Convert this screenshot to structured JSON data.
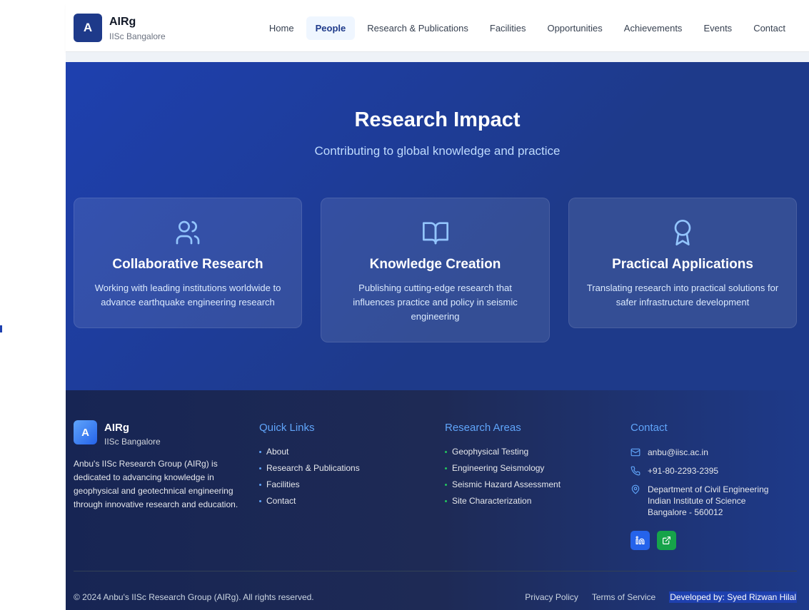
{
  "header": {
    "logo_letter": "A",
    "brand_name": "AIRg",
    "brand_sub": "IISc Bangalore",
    "nav": [
      {
        "label": "Home",
        "active": false
      },
      {
        "label": "People",
        "active": true
      },
      {
        "label": "Research & Publications",
        "active": false
      },
      {
        "label": "Facilities",
        "active": false
      },
      {
        "label": "Opportunities",
        "active": false
      },
      {
        "label": "Achievements",
        "active": false
      },
      {
        "label": "Events",
        "active": false
      },
      {
        "label": "Contact",
        "active": false
      }
    ]
  },
  "hero": {
    "title": "Research Impact",
    "subtitle": "Contributing to global knowledge and practice",
    "cards": [
      {
        "icon": "users-icon",
        "title": "Collaborative Research",
        "desc": "Working with leading institutions worldwide to advance earthquake engineering research"
      },
      {
        "icon": "book-open-icon",
        "title": "Knowledge Creation",
        "desc": "Publishing cutting-edge research that influences practice and policy in seismic engineering"
      },
      {
        "icon": "award-icon",
        "title": "Practical Applications",
        "desc": "Translating research into practical solutions for safer infrastructure development"
      }
    ]
  },
  "footer": {
    "logo_letter": "A",
    "brand_name": "AIRg",
    "brand_sub": "IISc Bangalore",
    "description": "Anbu's IISc Research Group (AIRg) is dedicated to advancing knowledge in geophysical and geotechnical engineering through innovative research and education.",
    "quick_links": {
      "heading": "Quick Links",
      "items": [
        "About",
        "Research & Publications",
        "Facilities",
        "Contact"
      ]
    },
    "research_areas": {
      "heading": "Research Areas",
      "items": [
        "Geophysical Testing",
        "Engineering Seismology",
        "Seismic Hazard Assessment",
        "Site Characterization"
      ]
    },
    "contact": {
      "heading": "Contact",
      "email": "anbu@iisc.ac.in",
      "phone": "+91-80-2293-2395",
      "address_line1": "Department of Civil Engineering",
      "address_line2": "Indian Institute of Science",
      "address_line3": "Bangalore - 560012"
    },
    "copyright": "© 2024 Anbu's IISc Research Group (AIRg). All rights reserved.",
    "privacy": "Privacy Policy",
    "terms": "Terms of Service",
    "developer": "Developed by: Syed Rizwan Hilal"
  },
  "colors": {
    "brand_dark": "#1e3a8a",
    "hero_blue": "#1e40af",
    "footer_dark": "#172554",
    "accent_blue": "#60a5fa",
    "accent_green": "#22c55e"
  }
}
